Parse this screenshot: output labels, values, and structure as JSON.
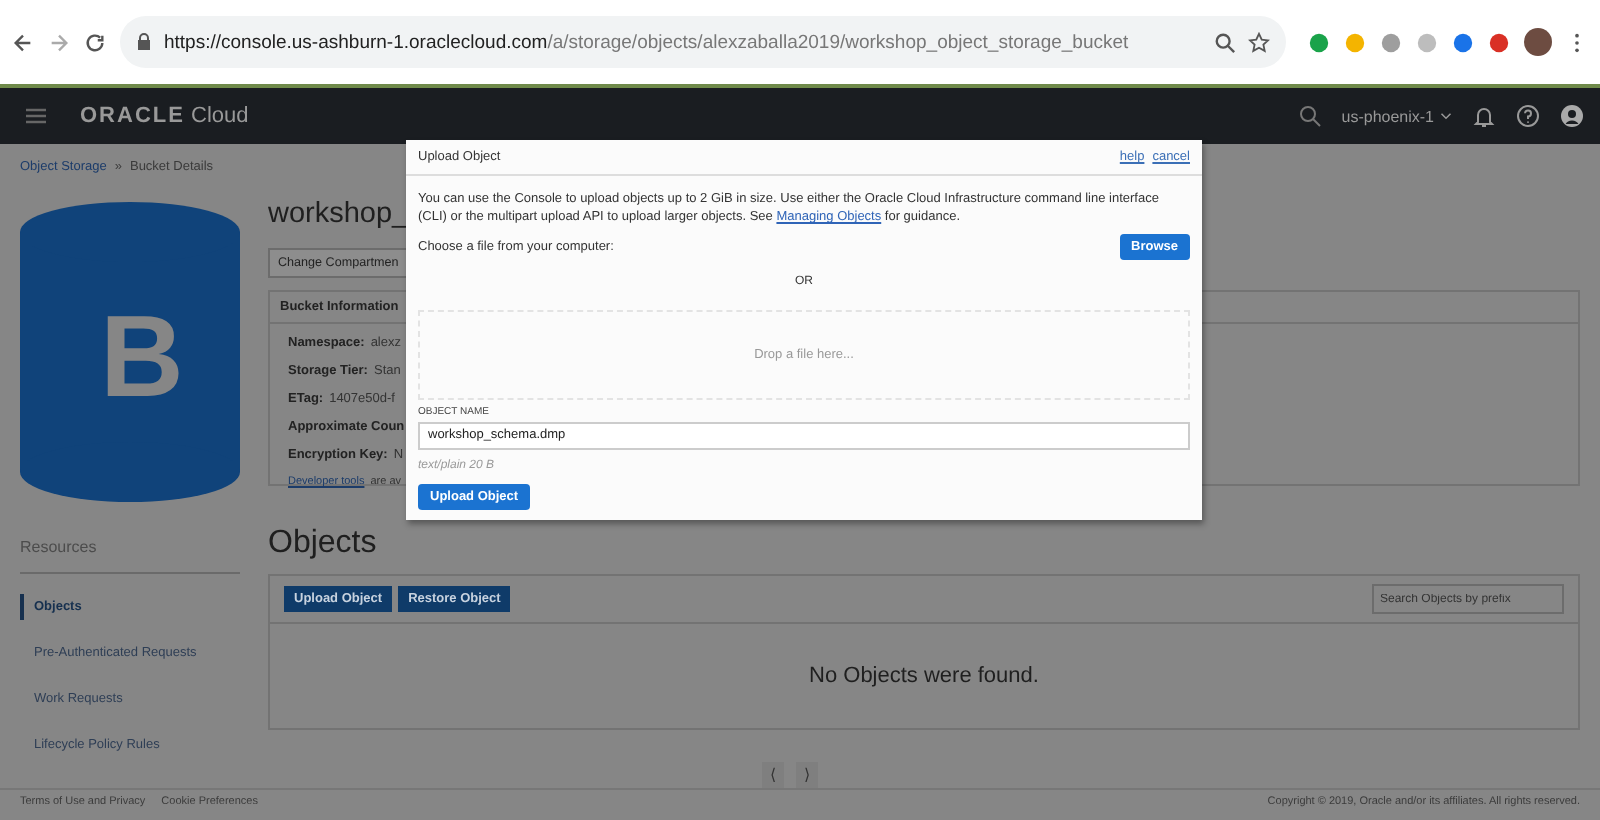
{
  "browser": {
    "url_host": "https://console.us-ashburn-1.oraclecloud.com",
    "url_path": "/a/storage/objects/alexzaballa2019/workshop_object_storage_bucket"
  },
  "header": {
    "logo": "ORACLE",
    "logo_suffix": "Cloud",
    "region": "us-phoenix-1"
  },
  "breadcrumb": [
    {
      "label": "Object Storage",
      "kind": "link"
    },
    {
      "label": "»",
      "kind": "sep"
    },
    {
      "label": "Bucket Details",
      "kind": "text"
    }
  ],
  "bucket": {
    "avatar_letter": "B",
    "title": "workshop_",
    "change_button": "Change Compartmen",
    "info_title": "Bucket Information",
    "rows": [
      {
        "label": "Namespace:",
        "value": "alexz"
      },
      {
        "label": "Storage Tier:",
        "value": "Stan"
      },
      {
        "label": "ETag:",
        "value": "1407e50d-f"
      },
      {
        "label": "Approximate Coun"
      },
      {
        "label": "Encryption Key:",
        "value": "N"
      }
    ],
    "dev_link": "Developer tools",
    "dev_text": "are av"
  },
  "sidebar": {
    "title": "Resources",
    "items": [
      {
        "label": "Objects",
        "selected": true
      },
      {
        "label": "Pre-Authenticated Requests",
        "selected": false
      },
      {
        "label": "Work Requests",
        "selected": false
      },
      {
        "label": "Lifecycle Policy Rules",
        "selected": false
      }
    ]
  },
  "objects": {
    "title": "Objects",
    "buttons": [
      "Upload Object",
      "Restore Object"
    ],
    "search": {
      "placeholder": "Search Objects by prefix"
    },
    "empty": "No Objects were found.",
    "pager": [
      "⟨",
      "⟩"
    ]
  },
  "footer": {
    "links": [
      "Terms of Use and Privacy",
      "Cookie Preferences"
    ],
    "copyright": "Copyright © 2019, Oracle and/or its affiliates. All rights reserved."
  },
  "dialog": {
    "title": "Upload Object",
    "links": [
      "help",
      "cancel"
    ],
    "intro": "You can use the Console to upload objects up to 2 GiB in size. Use either the Oracle Cloud Infrastructure command line interface (CLI) or the multipart upload API to upload larger objects. See",
    "intro_link": "Managing Objects",
    "intro_end": "for guidance.",
    "choose": "Choose a file from your computer:",
    "browse": "Browse",
    "or": "OR",
    "drop": "Drop a file here...",
    "name_label": "OBJECT NAME",
    "name_value": "workshop_schema.dmp",
    "file_info": "text/plain 20 B",
    "submit": "Upload Object"
  }
}
